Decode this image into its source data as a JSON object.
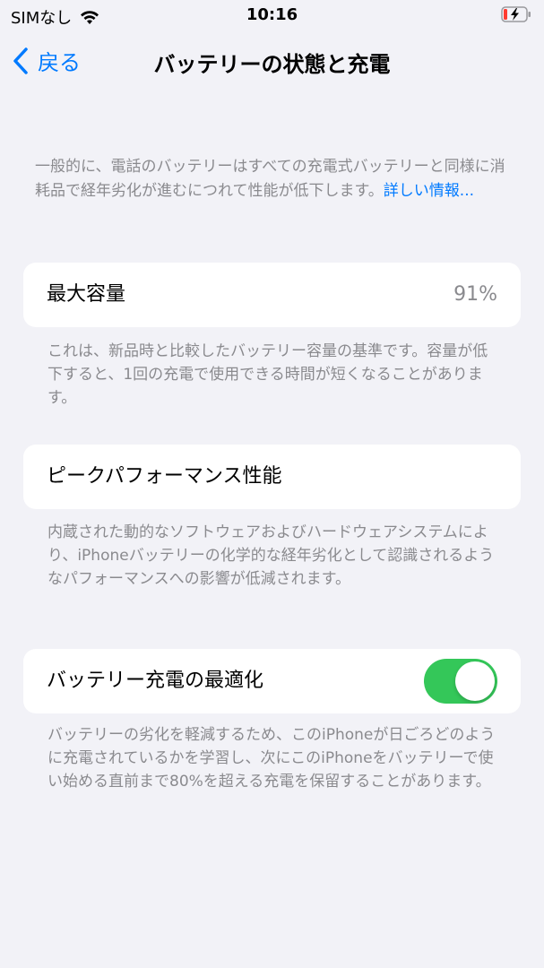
{
  "status_bar": {
    "carrier": "SIMなし",
    "time": "10:16",
    "wifi_icon": "wifi-icon",
    "battery_icon": "battery-charging-icon",
    "battery_color": "#ff3b30"
  },
  "nav": {
    "back_label": "戻る",
    "title": "バッテリーの状態と充電"
  },
  "intro": {
    "text": "一般的に、電話のバッテリーはすべての充電式バッテリーと同様に消耗品で経年劣化が進むにつれて性能が低下します。",
    "link": "詳しい情報..."
  },
  "max_capacity": {
    "label": "最大容量",
    "value": "91%",
    "footnote": "これは、新品時と比較したバッテリー容量の基準です。容量が低下すると、1回の充電で使用できる時間が短くなることがあります。"
  },
  "peak_performance": {
    "label": "ピークパフォーマンス性能",
    "footnote": "内蔵された動的なソフトウェアおよびハードウェアシステムにより、iPhoneバッテリーの化学的な経年劣化として認識されるようなパフォーマンスへの影響が低減されます。"
  },
  "optimized_charging": {
    "label": "バッテリー充電の最適化",
    "enabled": true,
    "toggle_color": "#34c759",
    "footnote": "バッテリーの劣化を軽減するため、このiPhoneが日ごろどのように充電されているかを学習し、次にこのiPhoneをバッテリーで使い始める直前まで80%を超える充電を保留することがあります。"
  },
  "colors": {
    "accent": "#007aff",
    "background": "#f2f2f7",
    "secondary_text": "#8a8a8e"
  }
}
